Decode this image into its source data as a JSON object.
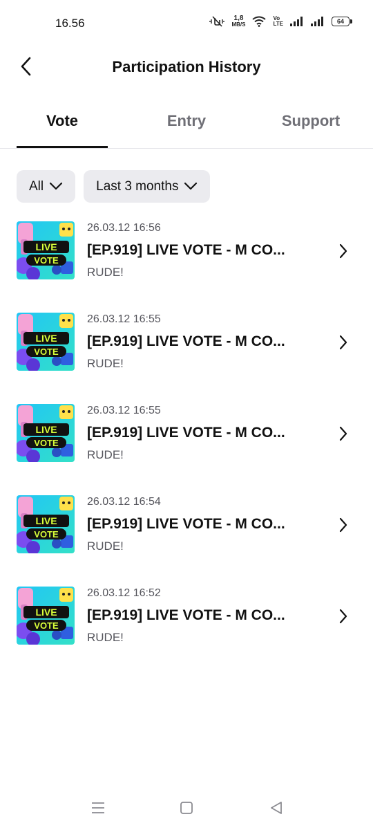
{
  "status_bar": {
    "time": "16.56",
    "net_speed_value": "1,8",
    "net_speed_unit": "MB/S",
    "volte_top": "Vo",
    "volte_bottom": "LTE",
    "battery": "64"
  },
  "header": {
    "title": "Participation History"
  },
  "tabs": [
    {
      "label": "Vote",
      "active": true
    },
    {
      "label": "Entry",
      "active": false
    },
    {
      "label": "Support",
      "active": false
    }
  ],
  "filters": {
    "type": "All",
    "period": "Last 3 months"
  },
  "thumbnail_text": {
    "line1": "LIVE",
    "line2": "VOTE"
  },
  "items": [
    {
      "date": "26.03.12 16:56",
      "title": "[EP.919] LIVE VOTE - M CO...",
      "subtitle": "RUDE!"
    },
    {
      "date": "26.03.12 16:55",
      "title": "[EP.919] LIVE VOTE - M CO...",
      "subtitle": "RUDE!"
    },
    {
      "date": "26.03.12 16:55",
      "title": "[EP.919] LIVE VOTE - M CO...",
      "subtitle": "RUDE!"
    },
    {
      "date": "26.03.12 16:54",
      "title": "[EP.919] LIVE VOTE - M CO...",
      "subtitle": "RUDE!"
    },
    {
      "date": "26.03.12 16:52",
      "title": "[EP.919] LIVE VOTE - M CO...",
      "subtitle": "RUDE!"
    }
  ],
  "icons": {
    "back": "chevron-left-icon",
    "dropdown": "chevron-down-icon",
    "row_arrow": "chevron-right-icon",
    "nav_menu": "recent-apps-icon",
    "nav_home": "home-icon",
    "nav_back": "back-triangle-icon"
  },
  "colors": {
    "text_primary": "#111111",
    "text_secondary": "#55555c",
    "tab_inactive": "#6f6f76",
    "chip_bg": "#ebebef",
    "divider": "#e4e4e8"
  }
}
